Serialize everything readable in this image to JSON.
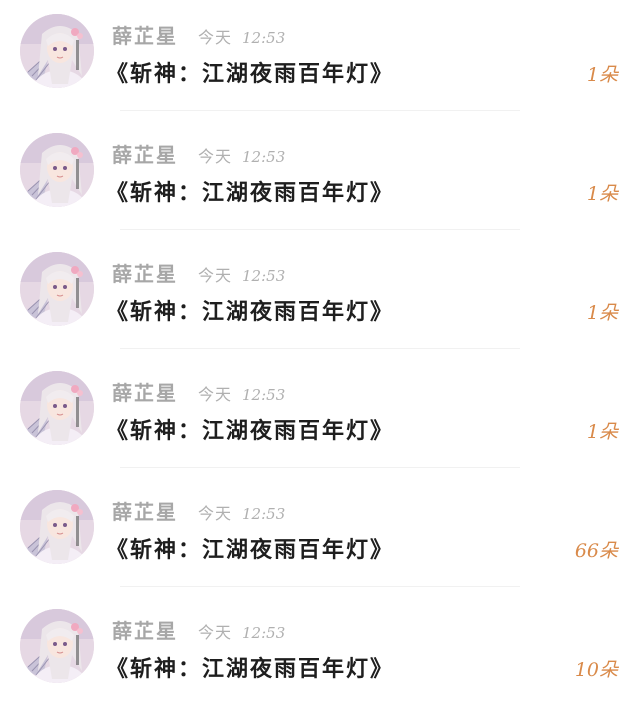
{
  "messages": [
    {
      "sender": "薛芷星",
      "date": "今天",
      "time": "12:53",
      "text": "《斩神：江湖夜雨百年灯》",
      "count": "1朵"
    },
    {
      "sender": "薛芷星",
      "date": "今天",
      "time": "12:53",
      "text": "《斩神：江湖夜雨百年灯》",
      "count": "1朵"
    },
    {
      "sender": "薛芷星",
      "date": "今天",
      "time": "12:53",
      "text": "《斩神：江湖夜雨百年灯》",
      "count": "1朵"
    },
    {
      "sender": "薛芷星",
      "date": "今天",
      "time": "12:53",
      "text": "《斩神：江湖夜雨百年灯》",
      "count": "1朵"
    },
    {
      "sender": "薛芷星",
      "date": "今天",
      "time": "12:53",
      "text": "《斩神：江湖夜雨百年灯》",
      "count": "66朵"
    },
    {
      "sender": "薛芷星",
      "date": "今天",
      "time": "12:53",
      "text": "《斩神：江湖夜雨百年灯》",
      "count": "10朵"
    }
  ],
  "colors": {
    "count_accent": "#d98a4a",
    "meta_gray": "#a7a7a7",
    "text_dark": "#1e1e1e"
  },
  "icons": {
    "avatar": "anime-girl-avatar-icon"
  }
}
